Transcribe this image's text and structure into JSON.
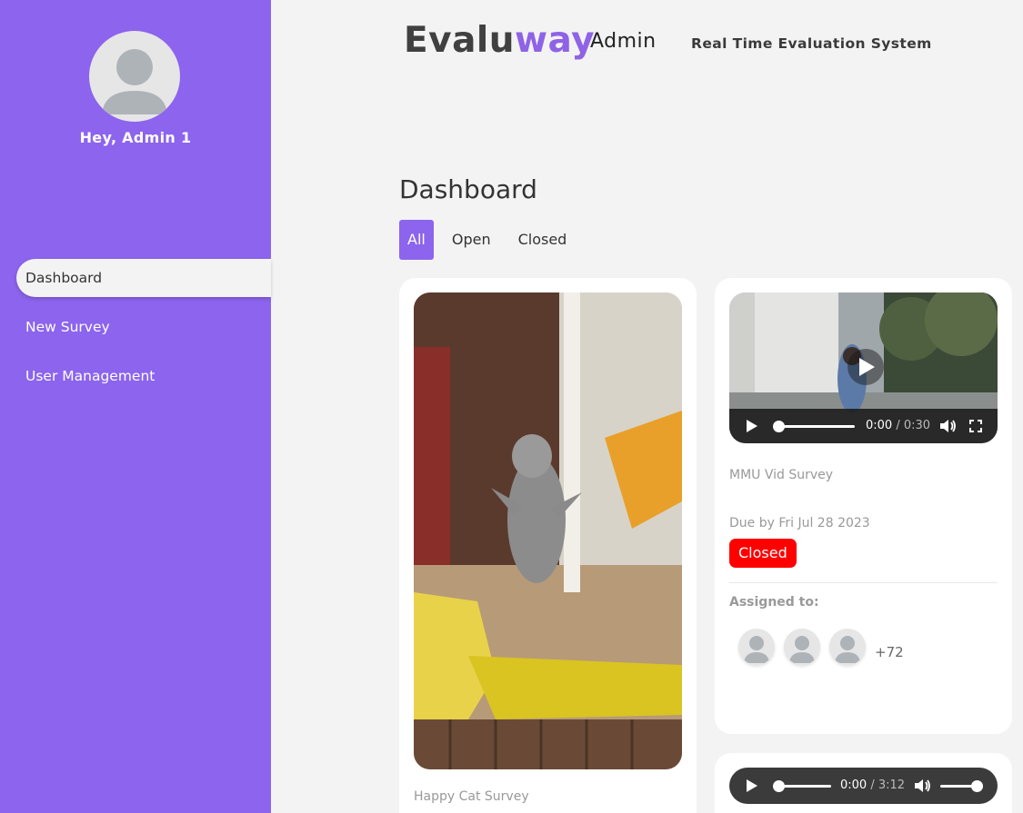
{
  "sidebar": {
    "greeting": "Hey, Admin 1",
    "items": [
      {
        "label": "Dashboard",
        "active": true
      },
      {
        "label": "New Survey",
        "active": false
      },
      {
        "label": "User Management",
        "active": false
      }
    ]
  },
  "header": {
    "brand_part1": "Evalu",
    "brand_part2": "way",
    "role": "Admin",
    "tagline": "Real Time Evaluation System"
  },
  "main": {
    "title": "Dashboard",
    "filters": [
      {
        "label": "All",
        "active": true
      },
      {
        "label": "Open",
        "active": false
      },
      {
        "label": "Closed",
        "active": false
      }
    ],
    "cards": [
      {
        "title": "Happy Cat Survey",
        "media": "image"
      },
      {
        "title": "MMU Vid Survey",
        "media": "video",
        "video_time": "0:00",
        "video_duration": "0:30",
        "due": "Due by Fri Jul 28 2023",
        "status": "Closed",
        "assigned_label": "Assigned to:",
        "assigned_more": "+72"
      },
      {
        "media": "audio",
        "audio_time": "0:00",
        "audio_duration": "3:12"
      }
    ]
  },
  "colors": {
    "accent": "#8c64ed",
    "closed": "#ff0000"
  }
}
